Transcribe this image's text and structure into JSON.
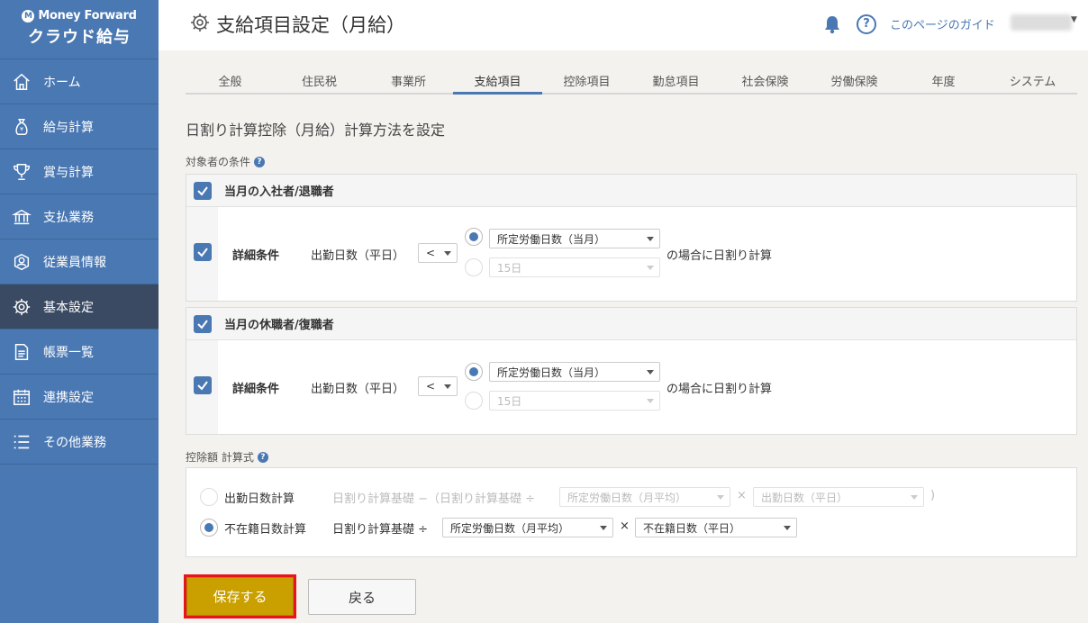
{
  "brand": {
    "line1": "Money Forward",
    "line2": "クラウド給与"
  },
  "sidebar": {
    "items": [
      {
        "label": "ホーム",
        "icon": "home-icon"
      },
      {
        "label": "給与計算",
        "icon": "money-bag-icon"
      },
      {
        "label": "賞与計算",
        "icon": "trophy-icon"
      },
      {
        "label": "支払業務",
        "icon": "bank-icon"
      },
      {
        "label": "従業員情報",
        "icon": "person-icon"
      },
      {
        "label": "基本設定",
        "icon": "gear-icon",
        "active": true
      },
      {
        "label": "帳票一覧",
        "icon": "document-icon"
      },
      {
        "label": "連携設定",
        "icon": "calendar-icon"
      },
      {
        "label": "その他業務",
        "icon": "list-icon"
      }
    ]
  },
  "header": {
    "title": "支給項目設定（月給）",
    "guide": "このページのガイド",
    "help": "?"
  },
  "tabs": [
    {
      "label": "全般"
    },
    {
      "label": "住民税"
    },
    {
      "label": "事業所"
    },
    {
      "label": "支給項目",
      "active": true
    },
    {
      "label": "控除項目"
    },
    {
      "label": "勤怠項目"
    },
    {
      "label": "社会保険"
    },
    {
      "label": "労働保険"
    },
    {
      "label": "年度"
    },
    {
      "label": "システム"
    }
  ],
  "section": {
    "title": "日割り計算控除（月給）計算方法を設定",
    "target_label": "対象者の条件",
    "formula_label": "控除額 計算式"
  },
  "panel1": {
    "title": "当月の入社者/退職者",
    "detail": "詳細条件",
    "field": "出勤日数（平日）",
    "operator": "<",
    "option1": "所定労働日数（当月）",
    "option2": "15日",
    "suffix": "の場合に日割り計算"
  },
  "panel2": {
    "title": "当月の休職者/復職者",
    "detail": "詳細条件",
    "field": "出勤日数（平日）",
    "operator": "<",
    "option1": "所定労働日数（当月）",
    "option2": "15日",
    "suffix": "の場合に日割り計算"
  },
  "formula": {
    "opt1_label": "出勤日数計算",
    "opt1_text": "日割り計算基礎 −（日割り計算基礎 ÷",
    "opt1_sel1": "所定労働日数（月平均）",
    "opt1_sel2": "出勤日数（平日）",
    "opt1_close": ")",
    "opt2_label": "不在籍日数計算",
    "opt2_text": "日割り計算基礎 ÷",
    "opt2_sel1": "所定労働日数（月平均）",
    "opt2_sel2": "不在籍日数（平日）",
    "times": "×"
  },
  "buttons": {
    "save": "保存する",
    "back": "戻る"
  },
  "colors": {
    "sidebar": "#4a78b3",
    "active_nav": "#3a4a62",
    "save": "#c9a000",
    "highlight": "#e8141c"
  }
}
